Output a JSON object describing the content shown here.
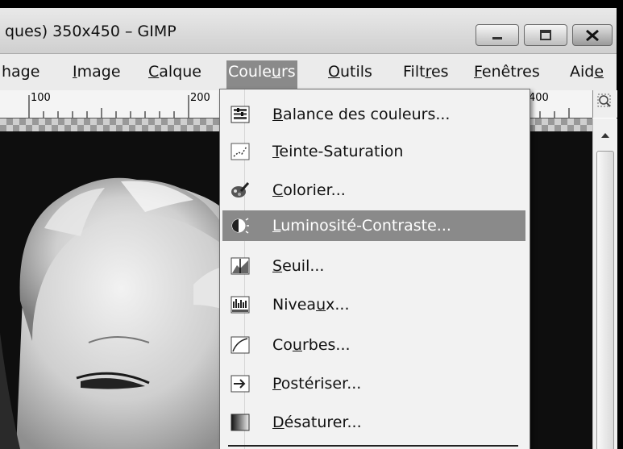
{
  "window": {
    "title": "ques) 350x450 – GIMP"
  },
  "menubar": {
    "items": [
      {
        "pre": "",
        "u": "",
        "post": "hage"
      },
      {
        "pre": "",
        "u": "I",
        "post": "mage"
      },
      {
        "pre": "",
        "u": "C",
        "post": "alque"
      },
      {
        "pre": "Coule",
        "u": "u",
        "post": "rs"
      },
      {
        "pre": "",
        "u": "O",
        "post": "utils"
      },
      {
        "pre": "Filt",
        "u": "r",
        "post": "es"
      },
      {
        "pre": "",
        "u": "F",
        "post": "enêtres"
      },
      {
        "pre": "Aid",
        "u": "e",
        "post": ""
      }
    ]
  },
  "ruler": {
    "labels": [
      "100",
      "200",
      "400"
    ]
  },
  "dropdown": {
    "items": [
      {
        "pre": "",
        "u": "B",
        "post": "alance des couleurs...",
        "icon": "color-balance-icon"
      },
      {
        "pre": "",
        "u": "T",
        "post": "einte-Saturation",
        "icon": "hue-saturation-icon"
      },
      {
        "pre": "",
        "u": "C",
        "post": "olorier...",
        "icon": "colorize-icon"
      },
      {
        "pre": "",
        "u": "L",
        "post": "uminosité-Contraste...",
        "icon": "brightness-contrast-icon"
      },
      {
        "pre": "",
        "u": "S",
        "post": "euil...",
        "icon": "threshold-icon"
      },
      {
        "pre": "Nivea",
        "u": "u",
        "post": "x...",
        "icon": "levels-icon"
      },
      {
        "pre": "Co",
        "u": "u",
        "post": "rbes...",
        "icon": "curves-icon"
      },
      {
        "pre": "",
        "u": "P",
        "post": "ostériser...",
        "icon": "posterize-icon"
      },
      {
        "pre": "",
        "u": "D",
        "post": "ésaturer...",
        "icon": "desaturate-icon"
      }
    ]
  },
  "colors": {
    "menu_highlight": "#8a8a8a"
  }
}
